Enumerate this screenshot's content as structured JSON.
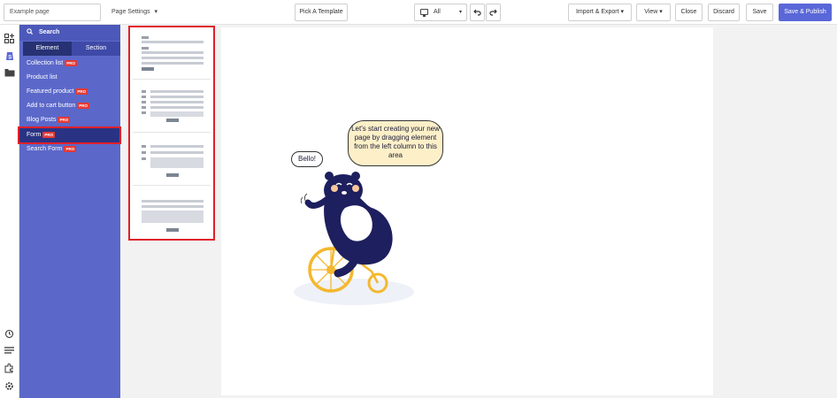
{
  "topbar": {
    "page_name_value": "Example page",
    "page_settings_label": "Page Settings",
    "pick_template_label": "Pick A Template",
    "device_value": "All",
    "import_export_label": "Import & Export",
    "view_label": "View",
    "close_label": "Close",
    "discard_label": "Discard",
    "save_label": "Save",
    "save_publish_label": "Save & Publish",
    "caret": "▾"
  },
  "rail": {
    "icons": [
      "add-section-icon",
      "shopify-icon",
      "folder-icon",
      "history-icon",
      "layers-icon",
      "puzzle-icon",
      "settings-icon"
    ]
  },
  "panel": {
    "search_label": "Search",
    "tabs": [
      {
        "label": "Element",
        "active": true
      },
      {
        "label": "Section",
        "active": false
      }
    ],
    "items": [
      {
        "label": "Collection list",
        "pro": true
      },
      {
        "label": "Product list",
        "pro": false
      },
      {
        "label": "Featured product",
        "pro": true
      },
      {
        "label": "Add to cart button",
        "pro": true
      },
      {
        "label": "Blog Posts",
        "pro": true
      },
      {
        "label": "Form",
        "pro": true
      },
      {
        "label": "Search Form",
        "pro": true
      }
    ],
    "pro_badge": "PRO"
  },
  "canvas": {
    "speech_main": "Let's start creating your new page by dragging element from the left column to this area",
    "speech_small": "Bello!"
  },
  "colors": {
    "brand": "#5a67d8",
    "panel": "#5b68c9",
    "pro": "#e53935",
    "highlight": "#e0202a",
    "bear": "#1d1f5e",
    "wheel": "#f4b82e"
  }
}
